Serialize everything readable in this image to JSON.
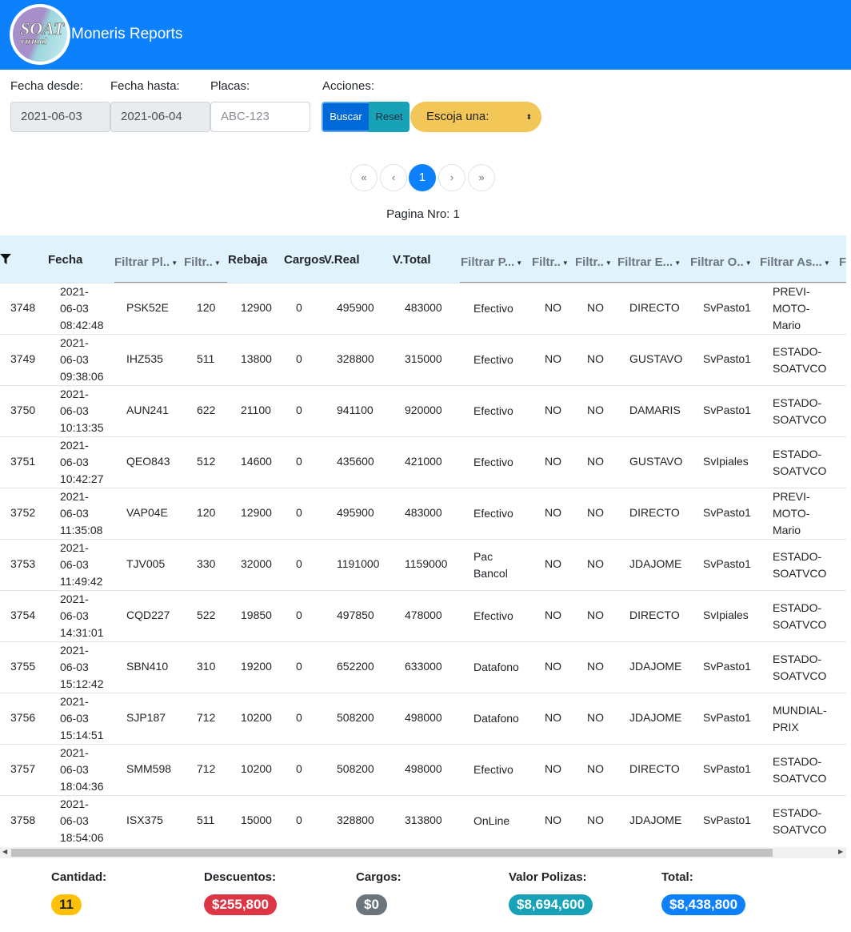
{
  "header": {
    "logo_text": "SOAT virtual",
    "brand": "Moneris Reports"
  },
  "filters": {
    "fecha_desde_label": "Fecha desde:",
    "fecha_desde_value": "2021-06-03",
    "fecha_hasta_label": "Fecha hasta:",
    "fecha_hasta_value": "2021-06-04",
    "placas_label": "Placas:",
    "placas_placeholder": "ABC-123",
    "acciones_label": "Acciones:",
    "buscar_label": "Buscar",
    "reset_label": "Reset",
    "select_value": "Escoja una:"
  },
  "pagination": {
    "first": "«",
    "prev": "‹",
    "current": "1",
    "next": "›",
    "last": "»",
    "page_label": "Pagina Nro: 1"
  },
  "table": {
    "headers": {
      "fecha": "Fecha",
      "placa": "Filtrar Pl..",
      "col3": "Filtr..",
      "rebaja": "Rebaja",
      "cargos": "Cargos",
      "vreal": "V.Real",
      "vtotal": "V.Total",
      "pago": "Filtrar P...",
      "col9": "Filtr..",
      "col10": "Filtr..",
      "empleado": "Filtrar E...",
      "oficina": "Filtrar O..",
      "asesor": "Filtrar As...",
      "extra": "Fi"
    },
    "rows": [
      {
        "id": "3748",
        "fecha": [
          "2021-",
          "06-03",
          "08:42:48"
        ],
        "placa": "PSK52E",
        "c3": "120",
        "rebaja": "12900",
        "cargos": "0",
        "vreal": "495900",
        "vtotal": "483000",
        "pago": [
          "Efectivo"
        ],
        "c9": "NO",
        "c10": "NO",
        "emp": "DIRECTO",
        "ofi": "SvPasto1",
        "ase": [
          "PREVI-",
          "MOTO-",
          "Mario"
        ]
      },
      {
        "id": "3749",
        "fecha": [
          "2021-",
          "06-03",
          "09:38:06"
        ],
        "placa": "IHZ535",
        "c3": "511",
        "rebaja": "13800",
        "cargos": "0",
        "vreal": "328800",
        "vtotal": "315000",
        "pago": [
          "Efectivo"
        ],
        "c9": "NO",
        "c10": "NO",
        "emp": "GUSTAVO",
        "ofi": "SvPasto1",
        "ase": [
          "ESTADO-",
          "SOATVCO"
        ]
      },
      {
        "id": "3750",
        "fecha": [
          "2021-",
          "06-03",
          "10:13:35"
        ],
        "placa": "AUN241",
        "c3": "622",
        "rebaja": "21100",
        "cargos": "0",
        "vreal": "941100",
        "vtotal": "920000",
        "pago": [
          "Efectivo"
        ],
        "c9": "NO",
        "c10": "NO",
        "emp": "DAMARIS",
        "ofi": "SvPasto1",
        "ase": [
          "ESTADO-",
          "SOATVCO"
        ]
      },
      {
        "id": "3751",
        "fecha": [
          "2021-",
          "06-03",
          "10:42:27"
        ],
        "placa": "QEO843",
        "c3": "512",
        "rebaja": "14600",
        "cargos": "0",
        "vreal": "435600",
        "vtotal": "421000",
        "pago": [
          "Efectivo"
        ],
        "c9": "NO",
        "c10": "NO",
        "emp": "GUSTAVO",
        "ofi": "SvIpiales",
        "ase": [
          "ESTADO-",
          "SOATVCO"
        ]
      },
      {
        "id": "3752",
        "fecha": [
          "2021-",
          "06-03",
          "11:35:08"
        ],
        "placa": "VAP04E",
        "c3": "120",
        "rebaja": "12900",
        "cargos": "0",
        "vreal": "495900",
        "vtotal": "483000",
        "pago": [
          "Efectivo"
        ],
        "c9": "NO",
        "c10": "NO",
        "emp": "DIRECTO",
        "ofi": "SvPasto1",
        "ase": [
          "PREVI-",
          "MOTO-",
          "Mario"
        ]
      },
      {
        "id": "3753",
        "fecha": [
          "2021-",
          "06-03",
          "11:49:42"
        ],
        "placa": "TJV005",
        "c3": "330",
        "rebaja": "32000",
        "cargos": "0",
        "vreal": "1191000",
        "vtotal": "1159000",
        "pago": [
          "Pac",
          "Bancol"
        ],
        "c9": "NO",
        "c10": "NO",
        "emp": "JDAJOME",
        "ofi": "SvPasto1",
        "ase": [
          "ESTADO-",
          "SOATVCO"
        ]
      },
      {
        "id": "3754",
        "fecha": [
          "2021-",
          "06-03",
          "14:31:01"
        ],
        "placa": "CQD227",
        "c3": "522",
        "rebaja": "19850",
        "cargos": "0",
        "vreal": "497850",
        "vtotal": "478000",
        "pago": [
          "Efectivo"
        ],
        "c9": "NO",
        "c10": "NO",
        "emp": "DIRECTO",
        "ofi": "SvIpiales",
        "ase": [
          "ESTADO-",
          "SOATVCO"
        ]
      },
      {
        "id": "3755",
        "fecha": [
          "2021-",
          "06-03",
          "15:12:42"
        ],
        "placa": "SBN410",
        "c3": "310",
        "rebaja": "19200",
        "cargos": "0",
        "vreal": "652200",
        "vtotal": "633000",
        "pago": [
          "Datafono"
        ],
        "c9": "NO",
        "c10": "NO",
        "emp": "JDAJOME",
        "ofi": "SvPasto1",
        "ase": [
          "ESTADO-",
          "SOATVCO"
        ]
      },
      {
        "id": "3756",
        "fecha": [
          "2021-",
          "06-03",
          "15:14:51"
        ],
        "placa": "SJP187",
        "c3": "712",
        "rebaja": "10200",
        "cargos": "0",
        "vreal": "508200",
        "vtotal": "498000",
        "pago": [
          "Datafono"
        ],
        "c9": "NO",
        "c10": "NO",
        "emp": "JDAJOME",
        "ofi": "SvPasto1",
        "ase": [
          "MUNDIAL-",
          "PRIX"
        ]
      },
      {
        "id": "3757",
        "fecha": [
          "2021-",
          "06-03",
          "18:04:36"
        ],
        "placa": "SMM598",
        "c3": "712",
        "rebaja": "10200",
        "cargos": "0",
        "vreal": "508200",
        "vtotal": "498000",
        "pago": [
          "Efectivo"
        ],
        "c9": "NO",
        "c10": "NO",
        "emp": "DIRECTO",
        "ofi": "SvPasto1",
        "ase": [
          "ESTADO-",
          "SOATVCO"
        ]
      },
      {
        "id": "3758",
        "fecha": [
          "2021-",
          "06-03",
          "18:54:06"
        ],
        "placa": "ISX375",
        "c3": "511",
        "rebaja": "15000",
        "cargos": "0",
        "vreal": "328800",
        "vtotal": "313800",
        "pago": [
          "OnLine"
        ],
        "c9": "NO",
        "c10": "NO",
        "emp": "JDAJOME",
        "ofi": "SvPasto1",
        "ase": [
          "ESTADO-",
          "SOATVCO"
        ]
      }
    ]
  },
  "totals": {
    "cantidad_label": "Cantidad:",
    "cantidad_value": "11",
    "cantidad_color": "#ffc107",
    "descuentos_label": "Descuentos:",
    "descuentos_value": "$255,800",
    "descuentos_color": "#dc3545",
    "cargos_label": "Cargos:",
    "cargos_value": "$0",
    "cargos_color": "#6c757d",
    "polizas_label": "Valor Polizas:",
    "polizas_value": "$8,694,600",
    "polizas_color": "#17a2b8",
    "total_label": "Total:",
    "total_value": "$8,438,800",
    "total_color": "#0d80fb"
  }
}
